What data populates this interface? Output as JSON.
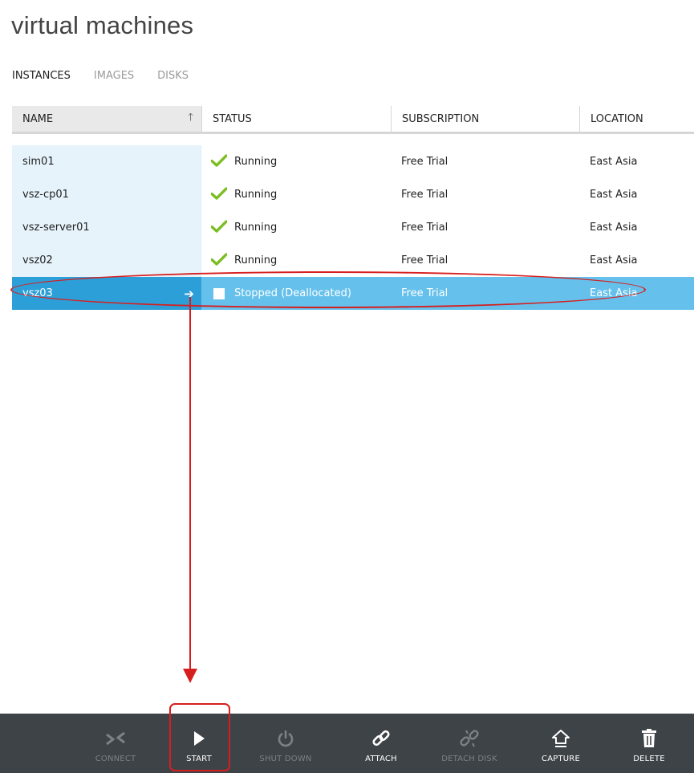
{
  "page": {
    "title": "virtual machines"
  },
  "tabs": [
    {
      "label": "INSTANCES",
      "active": true
    },
    {
      "label": "IMAGES",
      "active": false
    },
    {
      "label": "DISKS",
      "active": false
    }
  ],
  "grid": {
    "columns": {
      "name": "NAME",
      "status": "STATUS",
      "subscription": "SUBSCRIPTION",
      "location": "LOCATION"
    },
    "sort_column": "NAME",
    "sort_direction": "ascending",
    "rows": [
      {
        "name": "sim01",
        "status": "Running",
        "subscription": "Free Trial",
        "location": "East Asia",
        "selected": false
      },
      {
        "name": "vsz-cp01",
        "status": "Running",
        "subscription": "Free Trial",
        "location": "East Asia",
        "selected": false
      },
      {
        "name": "vsz-server01",
        "status": "Running",
        "subscription": "Free Trial",
        "location": "East Asia",
        "selected": false
      },
      {
        "name": "vsz02",
        "status": "Running",
        "subscription": "Free Trial",
        "location": "East Asia",
        "selected": false
      },
      {
        "name": "vsz03",
        "status": "Stopped (Deallocated)",
        "subscription": "Free Trial",
        "location": "East Asia",
        "selected": true
      }
    ]
  },
  "commands": [
    {
      "label": "CONNECT",
      "icon": "connect-icon",
      "enabled": false
    },
    {
      "label": "START",
      "icon": "play-icon",
      "enabled": true
    },
    {
      "label": "SHUT DOWN",
      "icon": "power-icon",
      "enabled": false
    },
    {
      "label": "ATTACH",
      "icon": "link-icon",
      "enabled": true
    },
    {
      "label": "DETACH DISK",
      "icon": "unlink-icon",
      "enabled": false
    },
    {
      "label": "CAPTURE",
      "icon": "capture-icon",
      "enabled": true
    },
    {
      "label": "DELETE",
      "icon": "trash-icon",
      "enabled": true
    }
  ],
  "colors": {
    "selected_row": "#65c1ec",
    "selected_name_cell": "#2d9fd8",
    "name_column_bg": "#e6f3fb",
    "running_check": "#7cbe22",
    "command_bar": "#3e4347",
    "annotation": "#d71e1e"
  }
}
